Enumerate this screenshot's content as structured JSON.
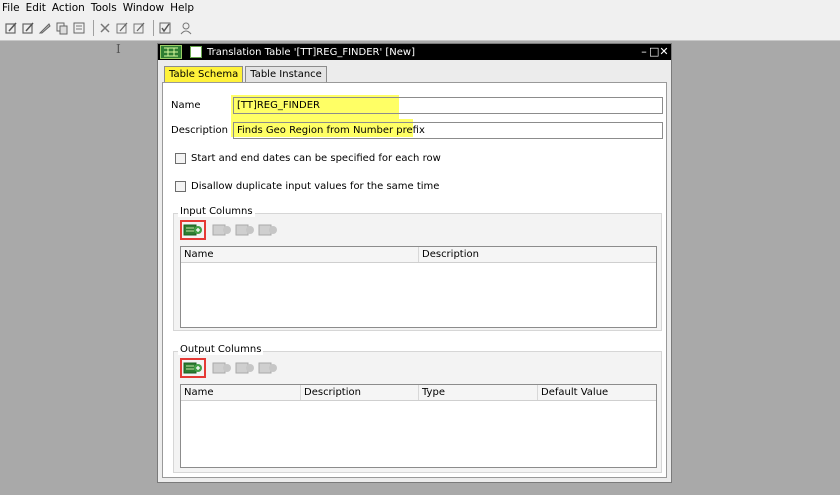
{
  "menu": [
    "File",
    "Edit",
    "Action",
    "Tools",
    "Window",
    "Help"
  ],
  "toolbar_icons": [
    "edit-icon",
    "edit-icon",
    "pen-icon",
    "copy-icon",
    "report-icon",
    "tools-icon",
    "edit-icon",
    "edit-icon",
    "validate-icon",
    "user-icon"
  ],
  "window": {
    "title": "Translation Table '[TT]REG_FINDER' [New]",
    "controls": [
      "–",
      "□",
      "✕"
    ]
  },
  "tabs": [
    "Table Schema",
    "Table Instance"
  ],
  "form": {
    "name_label": "Name",
    "name_value": "[TT]REG_FINDER",
    "description_label": "Description",
    "description_value": "Finds Geo Region from Number prefix",
    "checkbox_dates": "Start and end dates can be specified for each row",
    "checkbox_duplicate": "Disallow duplicate input values for the same time"
  },
  "input_columns": {
    "title": "Input Columns",
    "headers": [
      "Name",
      "Description"
    ]
  },
  "output_columns": {
    "title": "Output Columns",
    "headers": [
      "Name",
      "Description",
      "Type",
      "Default Value"
    ]
  },
  "colors": {
    "highlight": "#ffff4a",
    "active_tab": "#fff23a",
    "annotation_box": "#e53935",
    "titlebar": "#000000"
  }
}
